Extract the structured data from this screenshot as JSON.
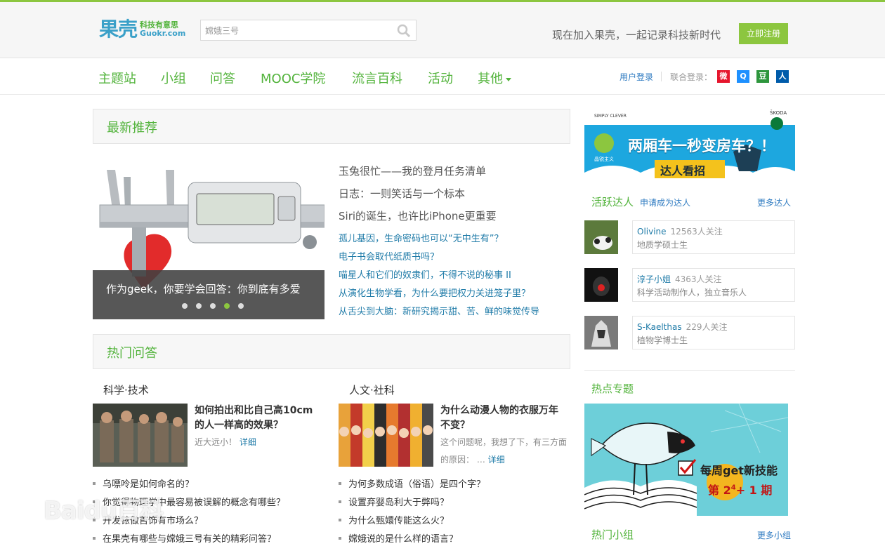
{
  "brand": {
    "name_cn": "果壳",
    "slogan": "科技有意思",
    "name_en": "Guokr.com"
  },
  "search": {
    "placeholder": "嫦娥三号"
  },
  "header": {
    "tagline": "现在加入果壳，一起记录科技新时代",
    "register_label": "立即注册"
  },
  "nav": {
    "items": [
      "主题站",
      "小组",
      "问答",
      "MOOC学院",
      "流言百科",
      "活动",
      "其他"
    ],
    "login_label": "用户登录",
    "union_login_label": "联合登录：",
    "social": [
      {
        "name": "weibo-icon",
        "glyph": "微",
        "color": "#e6162d"
      },
      {
        "name": "qq-icon",
        "glyph": "Q",
        "color": "#1e90ff"
      },
      {
        "name": "douban-icon",
        "glyph": "豆",
        "color": "#2e963d"
      },
      {
        "name": "renren-icon",
        "glyph": "人",
        "color": "#005baa"
      }
    ]
  },
  "latest": {
    "title": "最新推荐",
    "slide_caption": "作为geek，你要学会回答：你到底有多爱",
    "slide_dots": 5,
    "slide_active": 4,
    "big_items": [
      "玉兔很忙——我的登月任务清单",
      "日志：一则笑话与一个标本",
      "Siri的诞生，也许比iPhone更重要"
    ],
    "small_items": [
      "孤儿基因，生命密码也可以“无中生有”？",
      "电子书会取代纸质书吗？",
      "喵星人和它们的奴隶们，不得不说的秘事 II",
      "从演化生物学看，为什么要把权力关进笼子里？",
      "从舌尖到大脑：新研究揭示甜、苦、鲜的味觉传导"
    ]
  },
  "hot_qa": {
    "title": "热门问答",
    "columns": [
      {
        "category": "科学·技术",
        "feature_title": "如何拍出和比自己高10cm的人一样高的效果？",
        "feature_desc": "近大远小！",
        "detail_label": "详细",
        "list": [
          "乌嘌呤是如何命名的？",
          "你觉得物理学中最容易被误解的概念有哪些？",
          "开发铱做首饰有市场么？",
          "在果壳有哪些与嫦娥三号有关的精彩问答？"
        ]
      },
      {
        "category": "人文·社科",
        "feature_title": "为什么动漫人物的衣服万年不变？",
        "feature_desc": "这个问题呢，我想了下，有三方面的原因：",
        "ellipsis": "…",
        "detail_label": "详细",
        "list": [
          "为何多数成语（俗语）是四个字？",
          "设置弃婴岛利大于弊吗？",
          "为什么甄嬛传能这么火？",
          "嫦娥说的是什么样的语言？"
        ]
      }
    ]
  },
  "ad": {
    "brand_left": "SIMPLY CLEVER",
    "brand_right": "ŠKODA",
    "headline": "两厢车一秒变房车？！",
    "sub": "达人看招",
    "badge": "晶锐主义"
  },
  "experts": {
    "title": "活跃达人",
    "apply_label": "申请成为达人",
    "more_label": "更多达人",
    "users": [
      {
        "name": "Olivine",
        "fans": "12563人关注",
        "desc": "地质学硕士生"
      },
      {
        "name": "淳子小姐",
        "fans": "4363人关注",
        "desc": "科学活动制作人，独立音乐人"
      },
      {
        "name": "S-Kaelthas",
        "fans": "229人关注",
        "desc": "植物学博士生"
      }
    ]
  },
  "hot_topic": {
    "title": "热点专题",
    "line1": "每周get新技能",
    "line2_prefix": "第 2",
    "line2_sup": "4",
    "line2_suffix": "+ 1 期"
  },
  "hot_groups": {
    "title": "热门小组",
    "more_label": "更多小组"
  },
  "watermark": "Baidu百科",
  "colors": {
    "accent": "#52b33b",
    "link": "#1f7ba8",
    "button": "#8cc63f"
  }
}
